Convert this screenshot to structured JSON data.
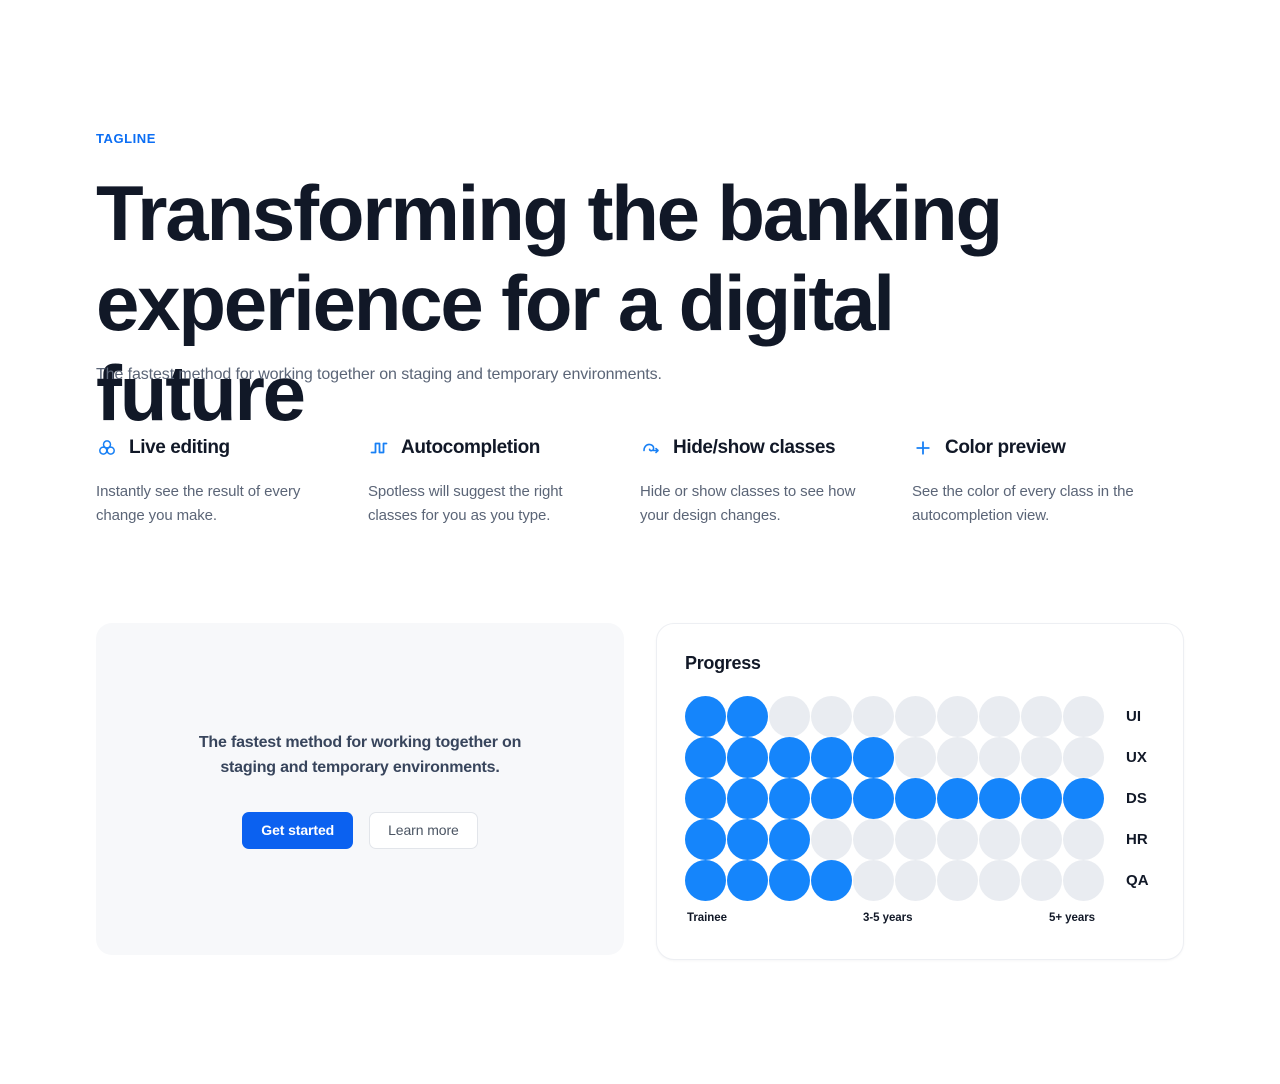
{
  "hero": {
    "tagline": "TAGLINE",
    "heading": "Transforming the banking experience for a digital future",
    "subtitle": "The fastest method for working together on staging and temporary environments."
  },
  "features": [
    {
      "icon": "venn-circles-icon",
      "title": "Live editing",
      "description": "Instantly see the result of every change you make."
    },
    {
      "icon": "square-wave-icon",
      "title": "Autocompletion",
      "description": "Spotless will suggest the right classes for you as you type."
    },
    {
      "icon": "hide-show-arrow-icon",
      "title": "Hide/show classes",
      "description": "Hide or show classes to see how your design changes."
    },
    {
      "icon": "plus-icon",
      "title": "Color preview",
      "description": "See the color of every class in the autocompletion view."
    }
  ],
  "cta_card": {
    "text": "The fastest method for working together on staging and temporary environments.",
    "primary_label": "Get started",
    "secondary_label": "Learn more"
  },
  "progress_card": {
    "title": "Progress",
    "colors": {
      "filled": "#1585fb",
      "empty": "#e9ecf1"
    },
    "axis_labels": [
      "Trainee",
      "3-5 years",
      "5+ years"
    ]
  },
  "chart_data": {
    "type": "bar",
    "title": "Progress",
    "subtype": "dot-matrix",
    "categories": [
      "UI",
      "UX",
      "DS",
      "HR",
      "QA"
    ],
    "values": [
      2,
      5,
      10,
      3,
      4
    ],
    "max": 10,
    "xlabel": "",
    "ylabel": "",
    "xlim": [
      0,
      10
    ],
    "tick_labels": [
      "Trainee",
      "3-5 years",
      "5+ years"
    ],
    "grid": false,
    "legend": false
  }
}
